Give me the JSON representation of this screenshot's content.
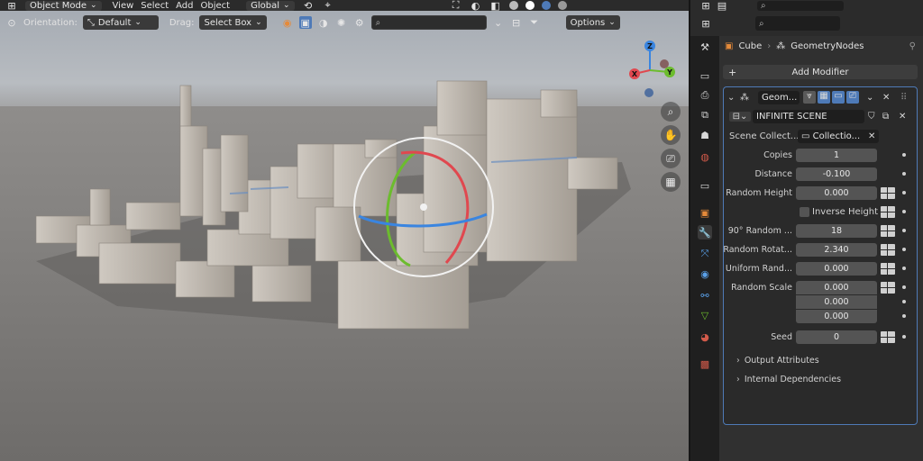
{
  "viewport_header": {
    "mode": "Object Mode",
    "menu": [
      "View",
      "Select",
      "Add",
      "Object"
    ],
    "transform_space": "Global",
    "orientation_label": "Orientation:",
    "orientation_value": "Default",
    "drag_label": "Drag:",
    "drag_value": "Select Box",
    "options_label": "Options"
  },
  "nav_gizmo": {
    "z": "Z",
    "x": "X",
    "y": "Y"
  },
  "properties": {
    "breadcrumb": {
      "object": "Cube",
      "modifier": "GeometryNodes"
    },
    "add_modifier": "Add Modifier",
    "modifier": {
      "name": "Geom...",
      "node_group": "INFINITE SCENE",
      "fields": {
        "scene_collection": {
          "label": "Scene Collect...",
          "value": "Collectio..."
        },
        "copies": {
          "label": "Copies",
          "value": "1"
        },
        "distance": {
          "label": "Distance",
          "value": "-0.100"
        },
        "random_height": {
          "label": "Random Height",
          "value": "0.000"
        },
        "inverse_height": {
          "label": "Inverse Height"
        },
        "random_90": {
          "label": "90° Random ...",
          "value": "18"
        },
        "random_rotation": {
          "label": "Random Rotat...",
          "value": "2.340"
        },
        "uniform_random": {
          "label": "Uniform Rand...",
          "value": "0.000"
        },
        "random_scale": {
          "label": "Random Scale",
          "values": [
            "0.000",
            "0.000",
            "0.000"
          ]
        },
        "seed": {
          "label": "Seed",
          "value": "0"
        }
      },
      "panels": [
        "Output Attributes",
        "Internal Dependencies"
      ]
    }
  },
  "colors": {
    "accent_blue": "#4e7ab7",
    "axis_x": "#e0484f",
    "axis_y": "#6cbc2e",
    "axis_z": "#3a85e0",
    "modifier_icon": "#5aa0e8"
  },
  "icons": [
    "editor-type-icon",
    "object-mode-icon",
    "cursor-icon",
    "pivot-icon",
    "snap-icon",
    "proportional-icon",
    "overlay-icon",
    "xray-icon",
    "shading-solid-icon",
    "search-icon",
    "filter-icon",
    "zoom-icon",
    "hand-icon",
    "camera-icon",
    "grid-icon",
    "wrench-icon",
    "pin-icon",
    "shield-icon",
    "copy-icon",
    "close-icon"
  ]
}
